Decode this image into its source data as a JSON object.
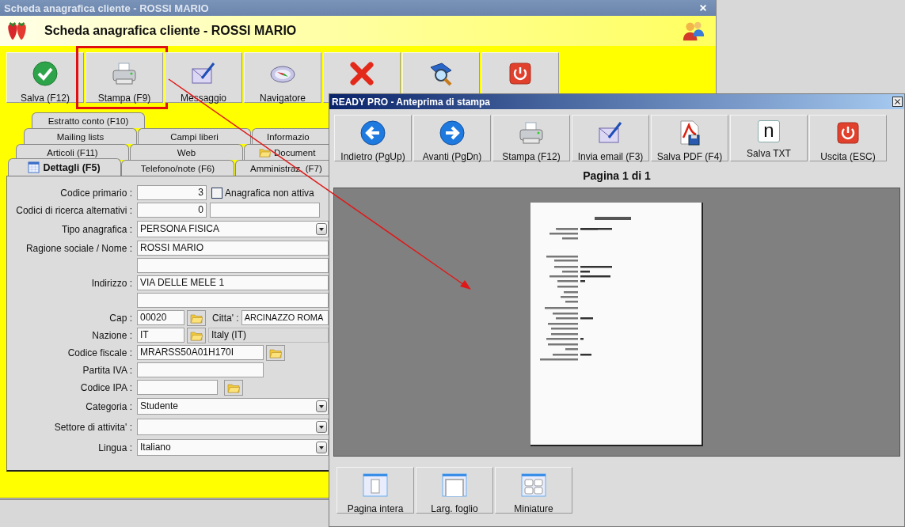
{
  "window": {
    "title": "Scheda anagrafica cliente - ROSSI MARIO"
  },
  "header": {
    "title": "Scheda anagrafica cliente - ROSSI MARIO"
  },
  "toolbar": [
    {
      "kind": "check",
      "label": "Salva (F12)",
      "highlighted": false
    },
    {
      "kind": "printer",
      "label": "Stampa (F9)",
      "highlighted": true
    },
    {
      "kind": "mail",
      "label": "Messaggio",
      "highlighted": false
    },
    {
      "kind": "compass",
      "label": "Navigatore",
      "highlighted": false
    },
    {
      "kind": "delete",
      "highlighted": false
    },
    {
      "kind": "book",
      "highlighted": false
    },
    {
      "kind": "power",
      "highlighted": false
    }
  ],
  "tab_rows": [
    {
      "tabs": [
        {
          "label": "Estratto conto (F10)",
          "selected": false
        }
      ]
    },
    {
      "tabs": [
        {
          "label": "Mailing lists",
          "selected": false
        },
        {
          "label": "Campi liberi",
          "selected": false
        },
        {
          "label": "Informazio",
          "selected": false
        }
      ]
    },
    {
      "tabs": [
        {
          "label": "Articoli (F11)",
          "selected": false
        },
        {
          "label": "Web",
          "selected": false
        },
        {
          "label": "Document",
          "selected": false,
          "kind": "folder"
        }
      ]
    },
    {
      "tabs": [
        {
          "label": "Dettagli (F5)",
          "selected": true,
          "kind": "calendar"
        },
        {
          "label": "Telefono/note (F6)",
          "selected": false
        },
        {
          "label": "Amministraz. (F7)",
          "selected": false
        }
      ]
    }
  ],
  "form": [
    {
      "kind": "code",
      "label": "Codice primario :",
      "value": "3",
      "check_label": "Anagrafica non attiva",
      "checked": false
    },
    {
      "kind": "codes",
      "label": "Codici di ricerca alternativi :",
      "value": "0"
    },
    {
      "kind": "select",
      "label": "Tipo anagrafica :",
      "value": "PERSONA FISICA"
    },
    {
      "kind": "text",
      "label": "Ragione sociale / Nome :",
      "value": "ROSSI MARIO"
    },
    {
      "kind": "text"
    },
    {
      "kind": "text",
      "label": "Indirizzo :",
      "value": "VIA DELLE MELE 1"
    },
    {
      "kind": "text"
    },
    {
      "kind": "cap",
      "label": "Cap :",
      "value": "00020",
      "city_label": "Citta' :",
      "city": "ARCINAZZO ROMA"
    },
    {
      "kind": "nation",
      "label": "Nazione :",
      "value": "IT",
      "country": "Italy (IT)"
    },
    {
      "kind": "fiscal",
      "label": "Codice fiscale :",
      "value": "MRARSS50A01H170I"
    },
    {
      "kind": "vat",
      "label": "Partita IVA :"
    },
    {
      "kind": "ipa",
      "label": "Codice IPA :"
    },
    {
      "kind": "select",
      "label": "Categoria :",
      "value": "Studente"
    },
    {
      "kind": "select",
      "label": "Settore di attivita' :"
    },
    {
      "kind": "select",
      "label": "Lingua :",
      "value": "Italiano"
    }
  ],
  "preview": {
    "title": "READY PRO - Anteprima di stampa",
    "toolbar": [
      {
        "kind": "back",
        "label": "Indietro (PgUp)"
      },
      {
        "kind": "forward",
        "label": "Avanti (PgDn)"
      },
      {
        "kind": "printer",
        "label": "Stampa (F12)"
      },
      {
        "kind": "mail",
        "label": "Invia email (F3)"
      },
      {
        "kind": "pdf",
        "label": "Salva PDF (F4)"
      },
      {
        "kind": "glyph",
        "glyph": "n",
        "label": "Salva TXT"
      },
      {
        "kind": "power",
        "label": "Uscita (ESC)"
      }
    ],
    "page_label": "Pagina 1 di 1",
    "view_buttons": [
      {
        "kind": "page",
        "label": "Pagina intera"
      },
      {
        "kind": "width",
        "label": "Larg. foglio"
      },
      {
        "kind": "thumbs",
        "label": "Miniature"
      }
    ]
  }
}
